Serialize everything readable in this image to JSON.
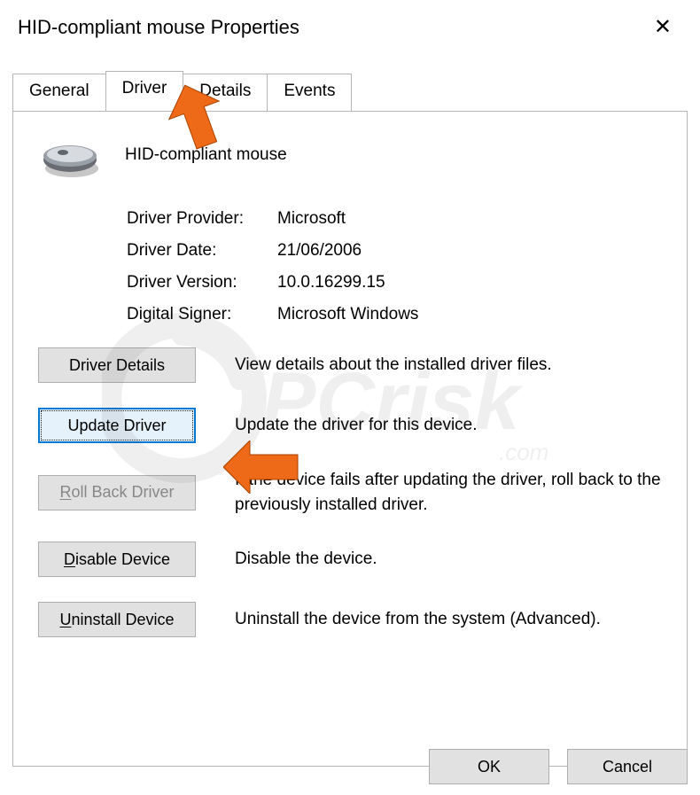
{
  "titlebar": {
    "title": "HID-compliant mouse Properties"
  },
  "tabs": {
    "general": "General",
    "driver": "Driver",
    "details": "Details",
    "events": "Events",
    "active": "driver"
  },
  "device": {
    "name": "HID-compliant mouse"
  },
  "fields": {
    "providerLabel": "Driver Provider:",
    "providerValue": "Microsoft",
    "dateLabel": "Driver Date:",
    "dateValue": "21/06/2006",
    "versionLabel": "Driver Version:",
    "versionValue": "10.0.16299.15",
    "signerLabel": "Digital Signer:",
    "signerValue": "Microsoft Windows"
  },
  "buttons": {
    "driverDetails": "Driver Details",
    "driverDetailsDesc": "View details about the installed driver files.",
    "updateDriver": "Update Driver",
    "updateDriverDesc": "Update the driver for this device.",
    "rollBack_pre": "R",
    "rollBack_post": "oll Back Driver",
    "rollBackDesc": "If the device fails after updating the driver, roll back to the previously installed driver.",
    "disable_pre": "D",
    "disable_post": "isable Device",
    "disableDesc": "Disable the device.",
    "uninstall_pre": "U",
    "uninstall_post": "ninstall Device",
    "uninstallDesc": "Uninstall the device from the system (Advanced).",
    "ok": "OK",
    "cancel": "Cancel"
  },
  "annotations": {
    "arrow_to_tab": "orange-arrow",
    "arrow_to_update": "orange-arrow"
  },
  "watermark": {
    "text": "pcrisk.com"
  }
}
